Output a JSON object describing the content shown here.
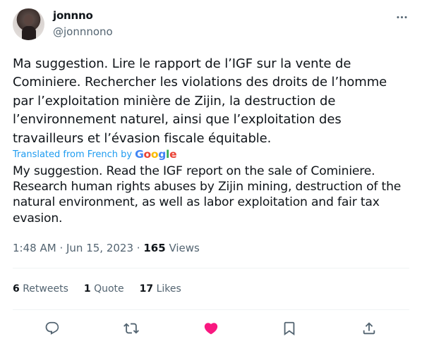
{
  "author": {
    "display_name": "jonnno",
    "handle": "@jonnnono"
  },
  "tweet": {
    "original_text": "Ma suggestion. Lire le rapport de l’IGF sur la vente de Cominiere. Rechercher les violations des droits de l’homme par l’exploitation minière de Zijin, la destruction de l’environnement naturel, ainsi que l’exploitation des travailleurs et l’évasion fiscale équitable.",
    "translated_label": "Translated from French by",
    "translated_provider": "Google",
    "translation_text": "My suggestion. Read the IGF report on the sale of Cominiere. Research human rights abuses by Zijin mining, destruction of the natural environment, as well as labor exploitation and fair tax evasion.",
    "time": "1:48 AM",
    "separator": "·",
    "date": "Jun 15, 2023",
    "views_count": "165",
    "views_label": "Views"
  },
  "stats": {
    "retweets_count": "6",
    "retweets_label": "Retweets",
    "quotes_count": "1",
    "quotes_label": "Quote",
    "likes_count": "17",
    "likes_label": "Likes"
  },
  "icons": {
    "more": "more-horizontal-icon",
    "reply": "reply-icon",
    "retweet": "retweet-icon",
    "like": "heart-icon",
    "bookmark": "bookmark-icon",
    "share": "share-icon"
  },
  "colors": {
    "text": "#0f1419",
    "secondary": "#536471",
    "link": "#1d9bf0",
    "like_active": "#f91880"
  }
}
